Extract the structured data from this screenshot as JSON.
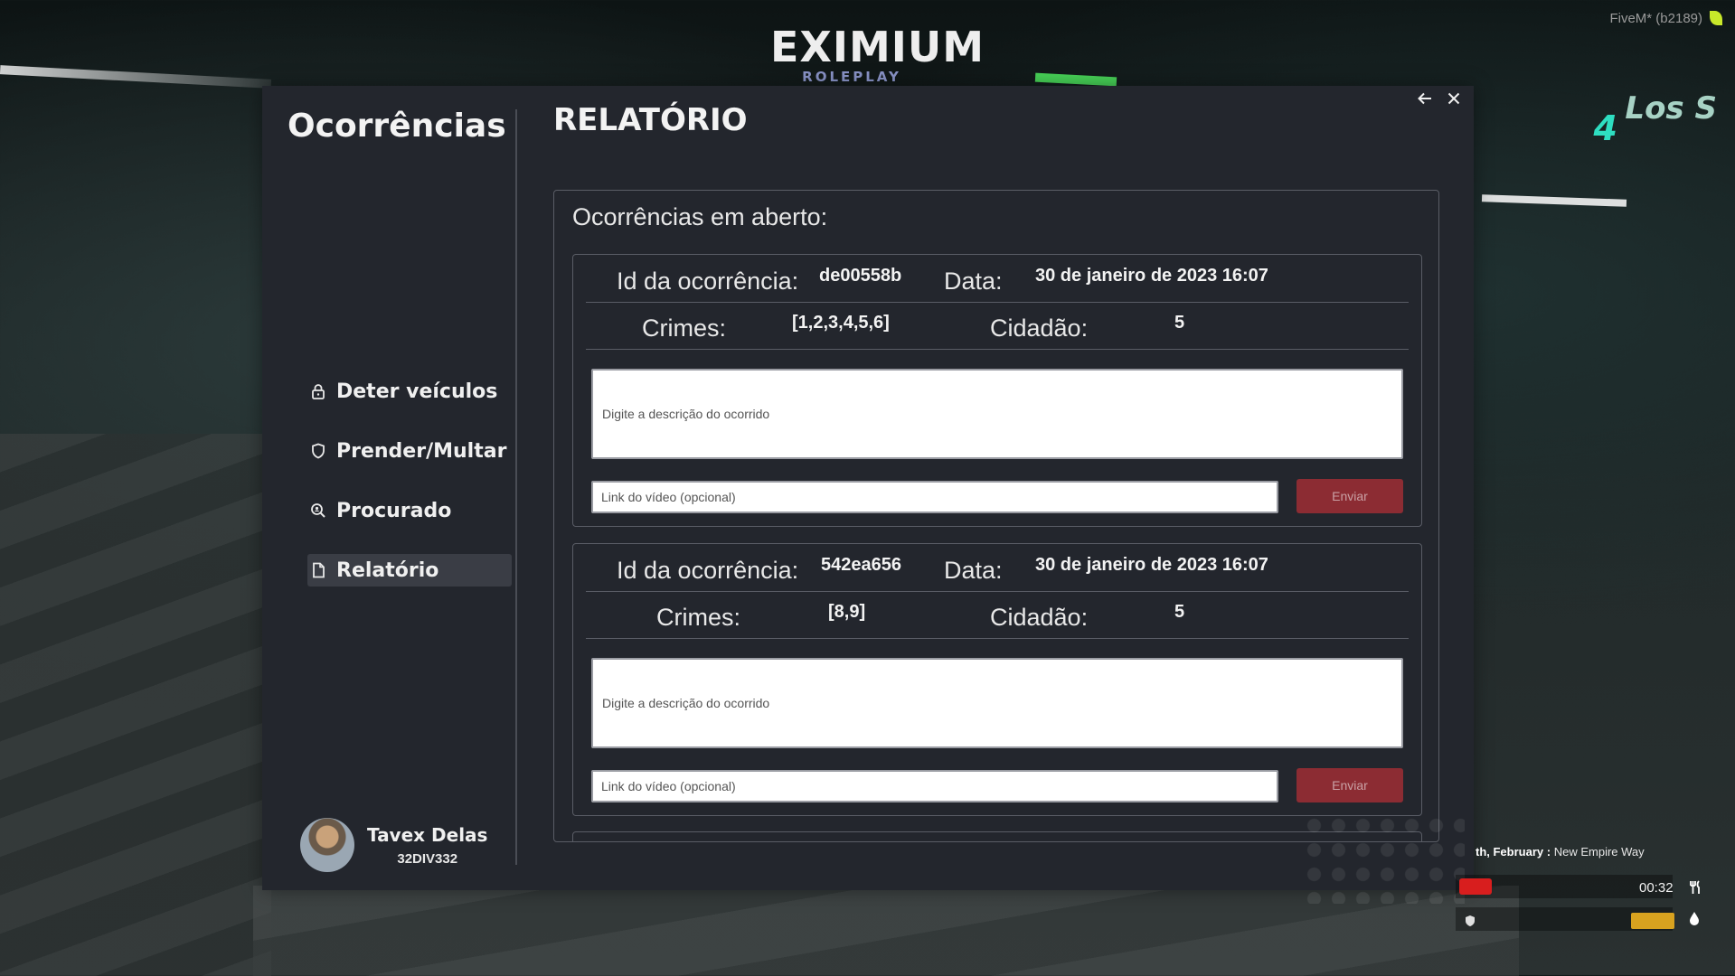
{
  "fivem": {
    "label": "FiveM* (b2189)"
  },
  "logo": {
    "main": "EXIMIUM",
    "sub": "ROLEPLAY"
  },
  "background": {
    "sign_number": "4",
    "sign_text": "Los S"
  },
  "sidebar": {
    "title": "Ocorrências",
    "items": [
      {
        "label": "Deter veículos",
        "icon": "lock-icon",
        "active": false
      },
      {
        "label": "Prender/Multar",
        "icon": "shield-icon",
        "active": false
      },
      {
        "label": "Procurado",
        "icon": "search-icon",
        "active": false
      },
      {
        "label": "Relatório",
        "icon": "document-icon",
        "active": true
      }
    ],
    "user": {
      "name": "Tavex Delas",
      "id": "32DIV332"
    }
  },
  "content": {
    "title": "RELATÓRIO",
    "heading": "Ocorrências em aberto:",
    "labels": {
      "id": "Id da ocorrência:",
      "date": "Data:",
      "crimes": "Crimes:",
      "citizen": "Cidadão:"
    },
    "occurrences": [
      {
        "id": "de00558b",
        "date": "30 de janeiro de 2023 16:07",
        "crimes": "[1,2,3,4,5,6]",
        "citizen": "5",
        "description_placeholder": "Digite a descrição do ocorrido",
        "video_placeholder": "Link do vídeo (opcional)",
        "send_label": "Enviar"
      },
      {
        "id": "542ea656",
        "date": "30 de janeiro de 2023 16:07",
        "crimes": "[8,9]",
        "citizen": "5",
        "description_placeholder": "Digite a descrição do ocorrido",
        "video_placeholder": "Link do vídeo (opcional)",
        "send_label": "Enviar"
      }
    ]
  },
  "hud": {
    "date_partial": "th, February",
    "separator": ":",
    "street": "New Empire Way",
    "time": "00:32"
  },
  "colors": {
    "panel_bg": "#23262d",
    "send_button": "#8c2c33",
    "hud_health": "#d81e1e",
    "hud_energy": "#d8a21f"
  }
}
